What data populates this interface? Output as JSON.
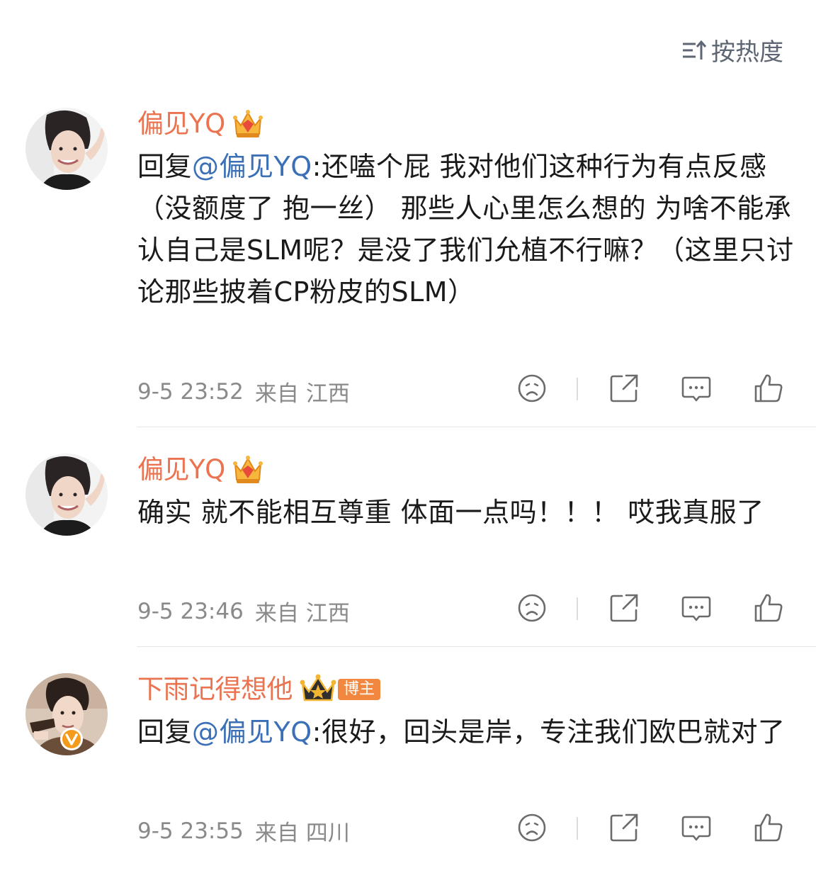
{
  "sort": {
    "label": "按热度",
    "icon": "sort-icon"
  },
  "comments": [
    {
      "username": "偏见YQ",
      "badge_icon": "crown-gem-icon",
      "reply_prefix": "回复",
      "mention": "@偏见YQ",
      "text": ":还嗑个屁  我对他们这种行为有点反感（没额度了 抱一丝）  那些人心里怎么想的  为啥不能承认自己是SLM呢？是没了我们允植不行嘛？（这里只讨论那些披着CP粉皮的SLM）",
      "date": "9-5 23:52",
      "from_label": "来自",
      "location": "江西"
    },
    {
      "username": "偏见YQ",
      "badge_icon": "crown-gem-icon",
      "reply_prefix": "",
      "mention": "",
      "text": "确实  就不能相互尊重  体面一点吗！！！ 哎我真服了",
      "date": "9-5 23:46",
      "from_label": "来自",
      "location": "江西"
    },
    {
      "username": "下雨记得想他",
      "badge_icon": "crown-star-icon",
      "tag": "博主",
      "reply_prefix": "回复",
      "mention": "@偏见YQ",
      "text": ":很好，回头是岸，专注我们欧巴就对了",
      "date": "9-5 23:55",
      "from_label": "来自",
      "location": "四川",
      "verified_icon": "verified-v-icon"
    }
  ],
  "actions": [
    "dislike-icon",
    "share-icon",
    "reply-icon",
    "like-icon"
  ],
  "colors": {
    "username": "#eb7350",
    "mention": "#3b6fb6",
    "meta": "#8a8a8a",
    "icon": "#6b6b6b",
    "blogger_tag": "#f2883f"
  }
}
